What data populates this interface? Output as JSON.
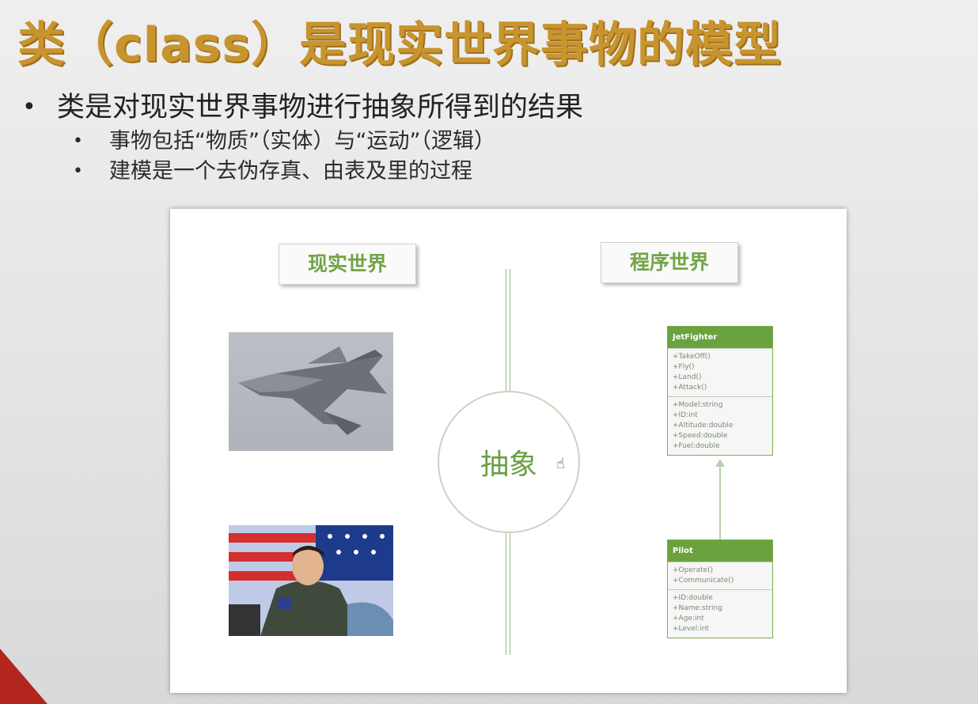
{
  "title": "类（class）是现实世界事物的模型",
  "bullets": {
    "main": "类是对现实世界事物进行抽象所得到的结果",
    "subs": [
      "事物包括“物质”（实体）与“运动”（逻辑）",
      "建模是一个去伪存真、由表及里的过程"
    ]
  },
  "diagram": {
    "left_heading": "现实世界",
    "right_heading": "程序世界",
    "center_label": "抽象",
    "images": [
      "fighter-jet-photo",
      "pilot-photo"
    ],
    "uml_jetfighter": {
      "name": "JetFighter",
      "methods": [
        "+TakeOff()",
        "+Fly()",
        "+Land()",
        "+Attack()"
      ],
      "fields": [
        "+Model:string",
        "+ID:int",
        "+Altitude:double",
        "+Speed:double",
        "+Fuel:double"
      ]
    },
    "uml_pilot": {
      "name": "Pilot",
      "methods": [
        "+Operate()",
        "+Communicate()"
      ],
      "fields": [
        "+ID:double",
        "+Name:string",
        "+Age:int",
        "+Level:int"
      ]
    }
  },
  "colors": {
    "title": "#c8942e",
    "accent_green": "#6aa23f",
    "heading_green": "#72a447"
  }
}
